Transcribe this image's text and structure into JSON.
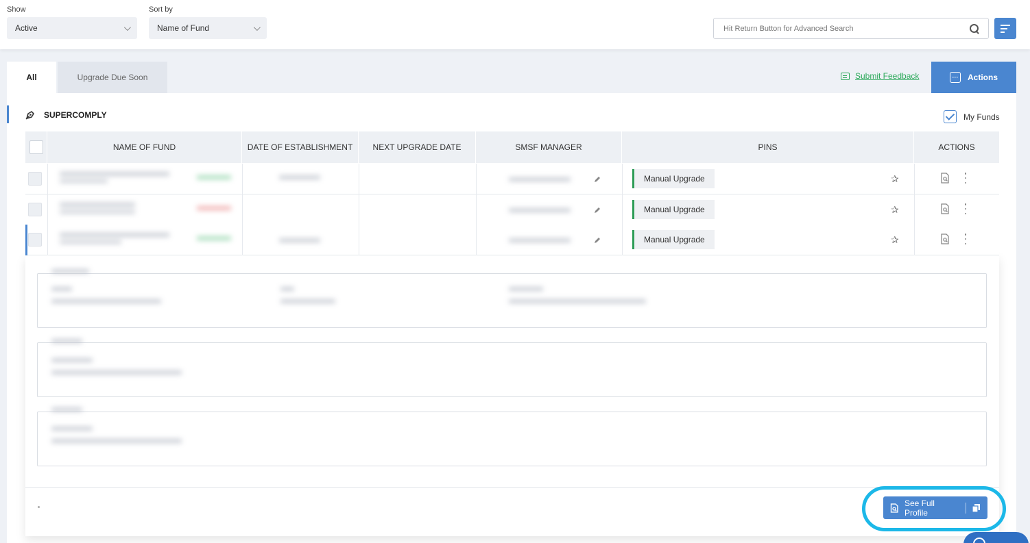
{
  "filters": {
    "show_label": "Show",
    "show_value": "Active",
    "sort_label": "Sort by",
    "sort_value": "Name of Fund",
    "search_placeholder": "Hit Return Button for Advanced Search"
  },
  "tabs": [
    {
      "label": "All",
      "active": true
    },
    {
      "label": "Upgrade Due Soon",
      "active": false
    }
  ],
  "feedback_label": "Submit Feedback",
  "actions_label": "Actions",
  "section_title": "SUPERCOMPLY",
  "my_funds_label": "My Funds",
  "my_funds_checked": true,
  "table": {
    "columns": [
      "NAME OF FUND",
      "DATE OF ESTABLISHMENT",
      "NEXT UPGRADE DATE",
      "SMSF MANAGER",
      "PINS",
      "ACTIONS"
    ],
    "rows": [
      {
        "pin": "Manual Upgrade",
        "status_color": "green"
      },
      {
        "pin": "Manual Upgrade",
        "status_color": "red"
      },
      {
        "pin": "Manual Upgrade",
        "status_color": "green"
      }
    ]
  },
  "full_profile_label": "See Full Profile",
  "colors": {
    "accent": "#4a86d0",
    "feedback": "#2eaa5c",
    "pin_border": "#2e9d57",
    "highlight": "#1cb8e8"
  }
}
